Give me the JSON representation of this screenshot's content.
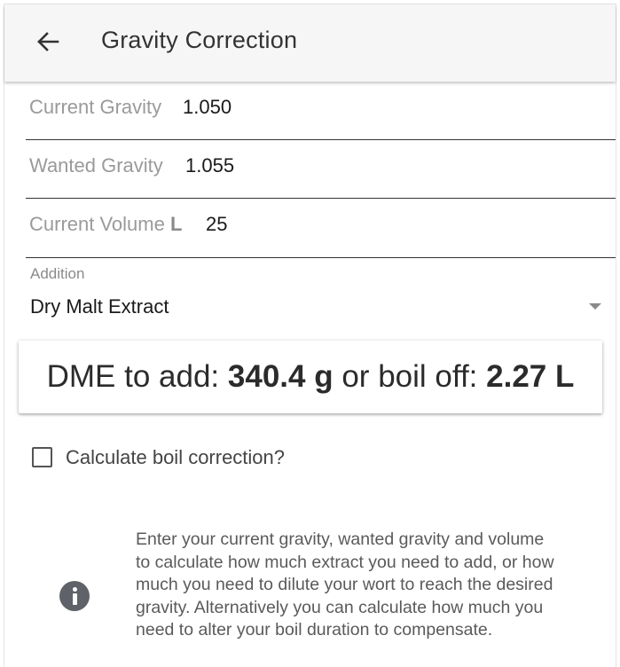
{
  "header": {
    "title": "Gravity Correction",
    "back_icon": "arrow-left-icon"
  },
  "fields": {
    "current_gravity": {
      "label": "Current Gravity",
      "value": "1.050"
    },
    "wanted_gravity": {
      "label": "Wanted Gravity",
      "value": "1.055"
    },
    "current_volume": {
      "label": "Current Volume",
      "unit": "L",
      "value": "25"
    }
  },
  "addition": {
    "label": "Addition",
    "selected": "Dry Malt Extract"
  },
  "result": {
    "prefix": "DME to add:",
    "amount": "340.4 g",
    "middle": "or boil off:",
    "boil_off": "2.27 L"
  },
  "boil_correction": {
    "label": "Calculate boil correction?",
    "checked": false
  },
  "info": {
    "icon": "info-icon",
    "text": "Enter your current gravity, wanted gravity and volume to calculate how much extract you need to add, or how much you need to dilute your wort to reach the desired gravity. Alternatively you can calculate how much you need to alter your boil duration to compensate."
  },
  "colors": {
    "app_bar": "#f6f6f6",
    "text_primary": "#1a1a1a",
    "text_label": "#9a9a9a",
    "icon_gray": "#5f6268"
  }
}
